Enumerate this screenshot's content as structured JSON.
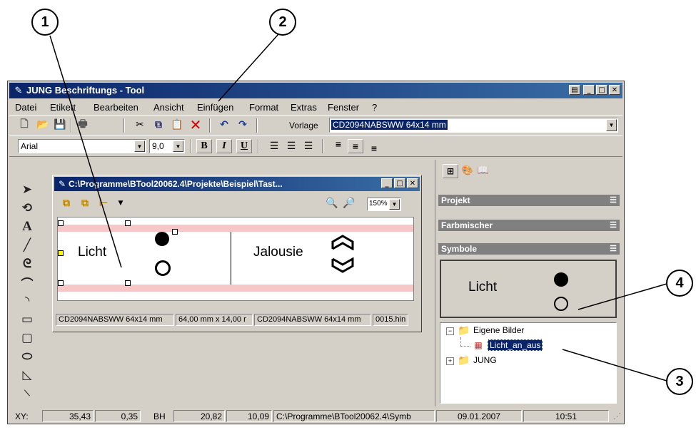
{
  "callouts": {
    "c1": "1",
    "c2": "2",
    "c3": "3",
    "c4": "4"
  },
  "app": {
    "title": "JUNG Beschriftungs - Tool",
    "menu": [
      "Datei",
      "Etikett",
      "Bearbeiten",
      "Ansicht",
      "Einfügen",
      "Format",
      "Extras",
      "Fenster",
      "?"
    ],
    "vorlage_label": "Vorlage",
    "vorlage_value": "CD2094NABSWW 64x14 mm",
    "font_value": "Arial",
    "size_value": "9,0",
    "bold": "B",
    "italic": "I",
    "underline": "U"
  },
  "doc": {
    "title": "C:\\Programme\\BTool20062.4\\Projekte\\Beispiel\\Tast...",
    "zoom": "150%",
    "label_left": "Licht",
    "label_right": "Jalousie",
    "status": [
      "CD2094NABSWW 64x14 mm",
      "64,00 mm x 14,00 r",
      "CD2094NABSWW 64x14 mm",
      "0015.hin"
    ]
  },
  "panel": {
    "projekt": "Projekt",
    "farbmischer": "Farbmischer",
    "symbole": "Symbole",
    "preview_text": "Licht",
    "tree": {
      "root": "Eigene Bilder",
      "child": "Licht_an_aus",
      "jung": "JUNG"
    }
  },
  "statusbar": {
    "xy_label": "XY:",
    "x": "35,43",
    "y": "0,35",
    "bh_label": "BH",
    "b": "20,82",
    "h": "10,09",
    "path": "C:\\Programme\\BTool20062.4\\Symb",
    "date": "09.01.2007",
    "time": "10:51"
  },
  "icons": [
    "new-icon",
    "open-icon",
    "save-icon",
    "print-icon",
    "cut-icon",
    "copy-icon",
    "paste-icon",
    "delete-icon",
    "undo-icon",
    "redo-icon",
    "pointer-icon",
    "rotate-icon",
    "text-icon",
    "line-icon",
    "polyline-icon",
    "curve-icon",
    "arc-icon",
    "rectangle-icon",
    "rounded-rectangle-icon",
    "ellipse-icon",
    "polygon-icon",
    "align-left-icon",
    "align-center-icon",
    "align-right-icon",
    "zoom-in-icon",
    "zoom-out-icon",
    "folder-icon",
    "image-icon"
  ]
}
